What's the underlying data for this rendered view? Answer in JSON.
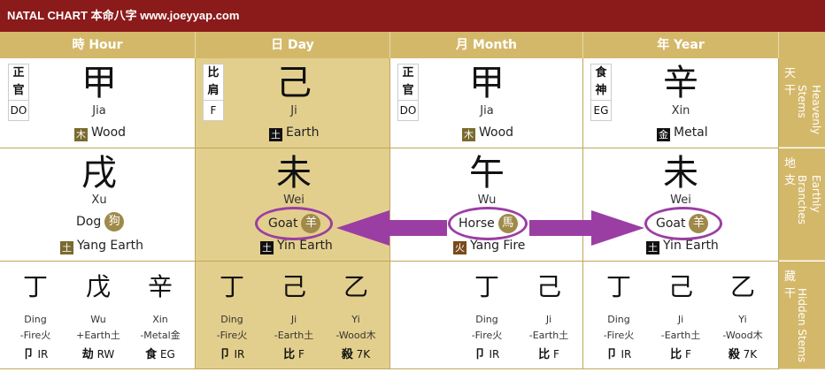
{
  "title": "NATAL CHART 本命八字 www.joeyyap.com",
  "headers": [
    "時 Hour",
    "日 Day",
    "月 Month",
    "年 Year"
  ],
  "side_labels": [
    {
      "cn": "天干",
      "en": "Heavenly Stems"
    },
    {
      "cn": "地支",
      "en": "Earthly Branches"
    },
    {
      "cn": "藏干",
      "en": "Hidden Stems"
    }
  ],
  "stems": [
    {
      "god_cn1": "正",
      "god_cn2": "官",
      "god_abbr": "DO",
      "char": "甲",
      "pinyin": "Jia",
      "elem_icon": "木",
      "elem": "Wood"
    },
    {
      "god_cn1": "比",
      "god_cn2": "肩",
      "god_abbr": "F",
      "char": "己",
      "pinyin": "Ji",
      "elem_icon": "土",
      "elem": "Earth"
    },
    {
      "god_cn1": "正",
      "god_cn2": "官",
      "god_abbr": "DO",
      "char": "甲",
      "pinyin": "Jia",
      "elem_icon": "木",
      "elem": "Wood"
    },
    {
      "god_cn1": "食",
      "god_cn2": "神",
      "god_abbr": "EG",
      "char": "辛",
      "pinyin": "Xin",
      "elem_icon": "金",
      "elem": "Metal"
    }
  ],
  "branches": [
    {
      "char": "戌",
      "pinyin": "Xu",
      "animal": "Dog",
      "animal_icon": "狗",
      "elem_icon": "土",
      "elem": "Yang Earth"
    },
    {
      "char": "未",
      "pinyin": "Wei",
      "animal": "Goat",
      "animal_icon": "羊",
      "elem_icon": "土",
      "elem": "Yin Earth"
    },
    {
      "char": "午",
      "pinyin": "Wu",
      "animal": "Horse",
      "animal_icon": "馬",
      "elem_icon": "火",
      "elem": "Yang Fire"
    },
    {
      "char": "未",
      "pinyin": "Wei",
      "animal": "Goat",
      "animal_icon": "羊",
      "elem_icon": "土",
      "elem": "Yin Earth"
    }
  ],
  "hidden": [
    [
      {
        "char": "丁",
        "pinyin": "Ding",
        "elem": "-Fire火",
        "god_cn": "卩",
        "god_abbr": "IR"
      },
      {
        "char": "戊",
        "pinyin": "Wu",
        "elem": "+Earth土",
        "god_cn": "劫",
        "god_abbr": "RW"
      },
      {
        "char": "辛",
        "pinyin": "Xin",
        "elem": "-Metal金",
        "god_cn": "食",
        "god_abbr": "EG"
      }
    ],
    [
      {
        "char": "丁",
        "pinyin": "Ding",
        "elem": "-Fire火",
        "god_cn": "卩",
        "god_abbr": "IR"
      },
      {
        "char": "己",
        "pinyin": "Ji",
        "elem": "-Earth土",
        "god_cn": "比",
        "god_abbr": "F"
      },
      {
        "char": "乙",
        "pinyin": "Yi",
        "elem": "-Wood木",
        "god_cn": "殺",
        "god_abbr": "7K"
      }
    ],
    [
      {
        "char": "丁",
        "pinyin": "Ding",
        "elem": "-Fire火",
        "god_cn": "卩",
        "god_abbr": "IR"
      },
      {
        "char": "己",
        "pinyin": "Ji",
        "elem": "-Earth土",
        "god_cn": "比",
        "god_abbr": "F"
      }
    ],
    [
      {
        "char": "丁",
        "pinyin": "Ding",
        "elem": "-Fire火",
        "god_cn": "卩",
        "god_abbr": "IR"
      },
      {
        "char": "己",
        "pinyin": "Ji",
        "elem": "-Earth土",
        "god_cn": "比",
        "god_abbr": "F"
      },
      {
        "char": "乙",
        "pinyin": "Yi",
        "elem": "-Wood木",
        "god_cn": "殺",
        "god_abbr": "7K"
      }
    ]
  ],
  "colors": {
    "title_bar": "#8b1a1a",
    "header": "#d4b86a",
    "day_pillar": "#e3cf8d",
    "wood": "#7a6a2e",
    "earth": "#111111",
    "metal": "#111111",
    "fire": "#111111",
    "highlight": "#9b3ea3"
  },
  "icons": {
    "element_badge": "square-element-glyph-icon",
    "animal_badge": "round-animal-glyph-icon",
    "arrow": "arrow-left-icon and arrow-right-icon"
  }
}
